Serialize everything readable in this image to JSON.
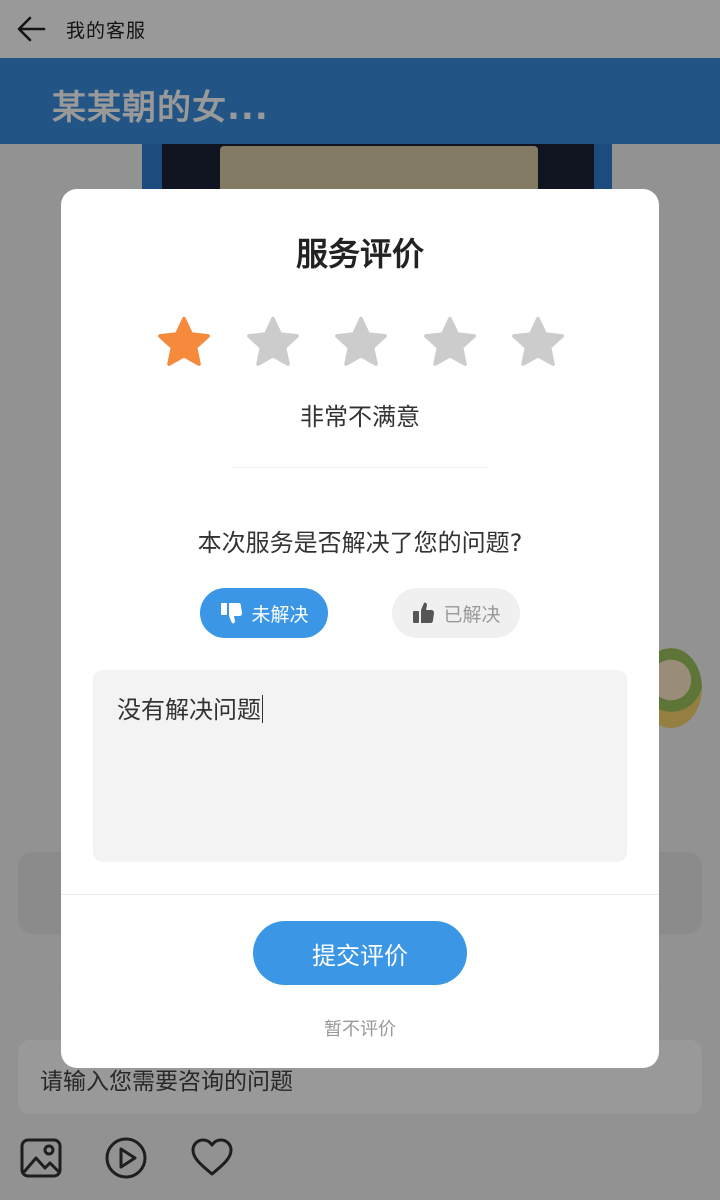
{
  "topbar": {
    "title": "我的客服",
    "back_icon": "arrow-left-icon"
  },
  "header": {
    "title": "某某朝的女..."
  },
  "chat_input": {
    "placeholder": "请输入您需要咨询的问题"
  },
  "toolbar": {
    "icons": [
      "image-icon",
      "play-circle-icon",
      "heart-icon"
    ]
  },
  "dialog": {
    "title": "服务评价",
    "rating": {
      "value": 1,
      "max": 5,
      "label": "非常不满意",
      "active_color": "#f58a3c",
      "inactive_color": "#cccccc"
    },
    "question": "本次服务是否解决了您的问题?",
    "choices": {
      "unresolved": {
        "label": "未解决",
        "icon": "thumbs-down-icon",
        "selected": true
      },
      "resolved": {
        "label": "已解决",
        "icon": "thumbs-up-icon",
        "selected": false
      }
    },
    "comment": {
      "value": "没有解决问题"
    },
    "submit_label": "提交评价",
    "skip_label": "暂不评价"
  },
  "colors": {
    "brand_blue": "#3b97e6",
    "header_blue": "#3a8ee0"
  }
}
